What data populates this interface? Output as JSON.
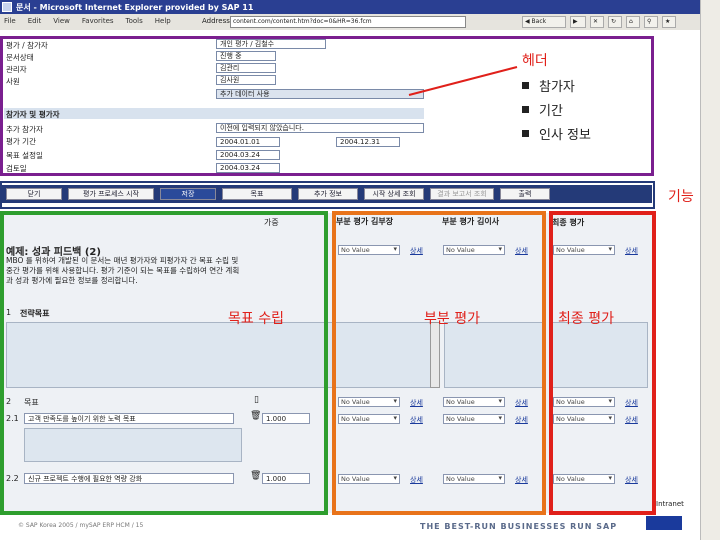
{
  "window": {
    "title": "문서 - Microsoft Internet Explorer provided by SAP 11"
  },
  "menu": [
    "File",
    "Edit",
    "View",
    "Favorites",
    "Tools",
    "Help"
  ],
  "address": {
    "label": "Address",
    "value": "content.com/content.htm?doc=0&HR=36.fcm"
  },
  "toolbar": {
    "back": "Back"
  },
  "form": {
    "labels": [
      "평가 / 참가자",
      "문서상태",
      "관리자",
      "사원"
    ],
    "values": [
      "개인 평가 / 김철수",
      "진행 중",
      "김관리",
      "김사원"
    ],
    "extra_value": "추가 데이터 사용",
    "section_title": "참가자 및 평가자",
    "labels2": [
      "추가 참가자",
      "평가 기간",
      "목표 설정일",
      "검토일"
    ],
    "values2": [
      "이전에 입력되지 않았습니다.",
      "2004.01.01",
      "2004.03.24",
      "2004.03.24"
    ],
    "period_to": "2004.12.31"
  },
  "annotations": {
    "header": "헤더",
    "header_bullets": [
      "참가자",
      "기간",
      "인사 정보"
    ],
    "function": "기능",
    "goal_setting": "목표 수립",
    "partial_eval": "부분 평가",
    "final_eval": "최종 평가"
  },
  "tabs": [
    "닫기",
    "평가 프로세스 시작",
    "저장",
    "목표",
    "추가 정보",
    "시작 상세 조회",
    "결과 보고서 조회",
    "출력"
  ],
  "grid": {
    "weight_label": "가중",
    "col_partial1": "부분 평가 김부장",
    "col_partial2": "부분 평가 김이사",
    "col_final": "최종 평가",
    "example_title": "예제: 성과 피드백 (2)",
    "example_text": "MBO 를 위하여 개발된 이 문서는 매년 평가자와 피평가자 간 목표 수립 및 중간 평가를 위해 사용합니다. 평가 기준이 되는 목표를 수립하여 연간 계획과 성과 평가에 필요한 정보를 정리합니다.",
    "row1_num": "1",
    "row1_label": "전략목표",
    "row2_num": "2",
    "row2_label": "목표",
    "row21_num": "2.1",
    "row21_text": "고객 만족도를 높이기 위한 노력 목표",
    "row22_num": "2.2",
    "row22_text": "신규 프로젝트 수행에 필요한 역량 강화",
    "weight_value": "1.000",
    "select_value": "No Value",
    "link_detail": "상세"
  },
  "footer": {
    "copyright": "© SAP Korea 2005 / mySAP ERP HCM / 15",
    "slogan": "THE BEST-RUN BUSINESSES RUN SAP",
    "status": "Intranet"
  },
  "colors": {
    "purple": "#7a1f8f",
    "blue": "#243a78",
    "green": "#2e9e2e",
    "orange": "#e8731a",
    "red": "#e0201a",
    "brand": "#1a3a9c"
  }
}
